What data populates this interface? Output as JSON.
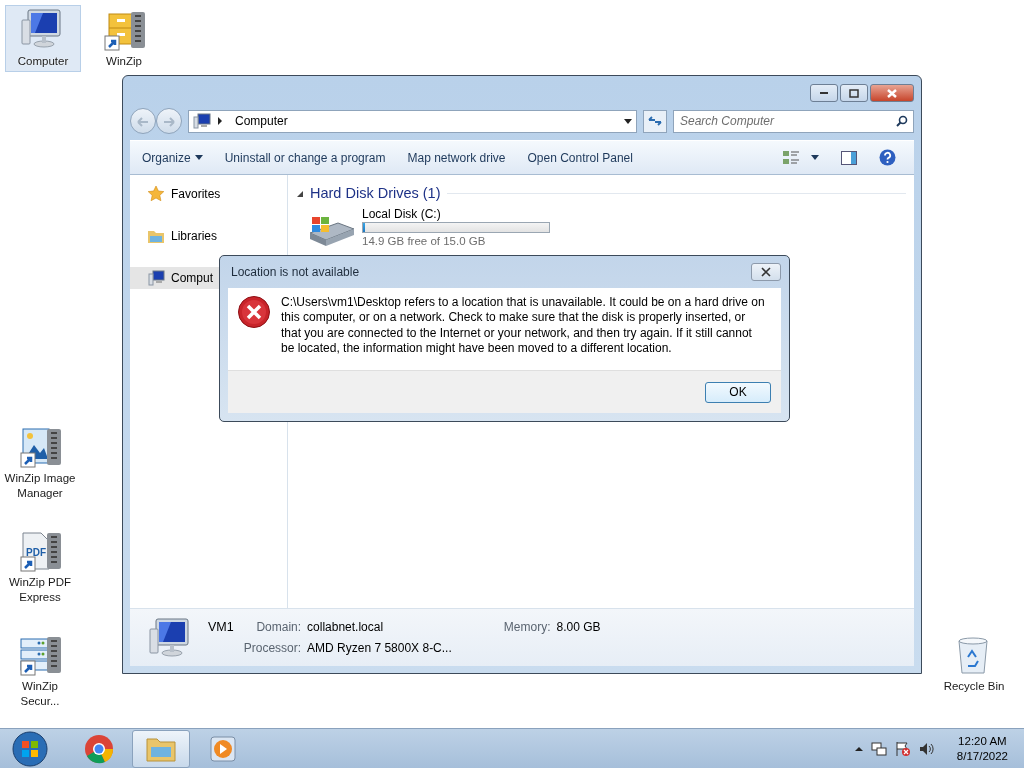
{
  "desktop_icons": [
    {
      "label": "Computer",
      "kind": "computer",
      "selected": true
    },
    {
      "label": "WinZip",
      "kind": "winzip",
      "selected": false
    },
    {
      "label": "WinZip Image Manager",
      "kind": "image",
      "selected": false
    },
    {
      "label": "WinZip PDF Express",
      "kind": "pdf",
      "badge": "PDF",
      "selected": false
    },
    {
      "label": "WinZip Secur...",
      "kind": "security",
      "selected": false
    },
    {
      "label": "Recycle Bin",
      "kind": "recycle",
      "selected": false
    }
  ],
  "explorer": {
    "address": "Computer",
    "search": {
      "placeholder": "Search Computer"
    },
    "toolbar": [
      {
        "label": "Organize",
        "dropdown": true
      },
      {
        "label": "Uninstall or change a program",
        "dropdown": false
      },
      {
        "label": "Map network drive",
        "dropdown": false
      },
      {
        "label": "Open Control Panel",
        "dropdown": false
      }
    ],
    "nav": [
      {
        "label": "Favorites",
        "kind": "star",
        "selected": false
      },
      {
        "label": "Libraries",
        "kind": "folder",
        "selected": false
      },
      {
        "label": "Comput",
        "kind": "computer",
        "selected": true
      }
    ],
    "group": {
      "title": "Hard Disk Drives (1)",
      "expanded": true
    },
    "drives": [
      {
        "name": "Local Disk (C:)",
        "level": 0.01,
        "free": "14.9 GB free of 15.0 GB"
      }
    ],
    "details": {
      "name": "VM1",
      "fields": [
        {
          "label": "Domain:",
          "value": "collabnet.local"
        },
        {
          "label": "Memory:",
          "value": "8.00 GB"
        },
        {
          "label": "Processor:",
          "value": "AMD Ryzen 7 5800X 8-C..."
        }
      ]
    }
  },
  "dialog": {
    "title": "Location is not available",
    "message": "C:\\Users\\vm1\\Desktop refers to a location that is unavailable. It could be on a hard drive on this computer, or on a network. Check to make sure that the disk is properly inserted, or that you are connected to the Internet or your network, and then try again. If it still cannot be located, the information might have been moved to a different location.",
    "buttons": [
      "OK"
    ]
  },
  "taskbar": {
    "apps": [
      {
        "kind": "chrome",
        "active": false
      },
      {
        "kind": "explorer",
        "active": true
      },
      {
        "kind": "media",
        "active": false
      }
    ],
    "time": "12:20 AM",
    "date": "8/17/2022"
  }
}
